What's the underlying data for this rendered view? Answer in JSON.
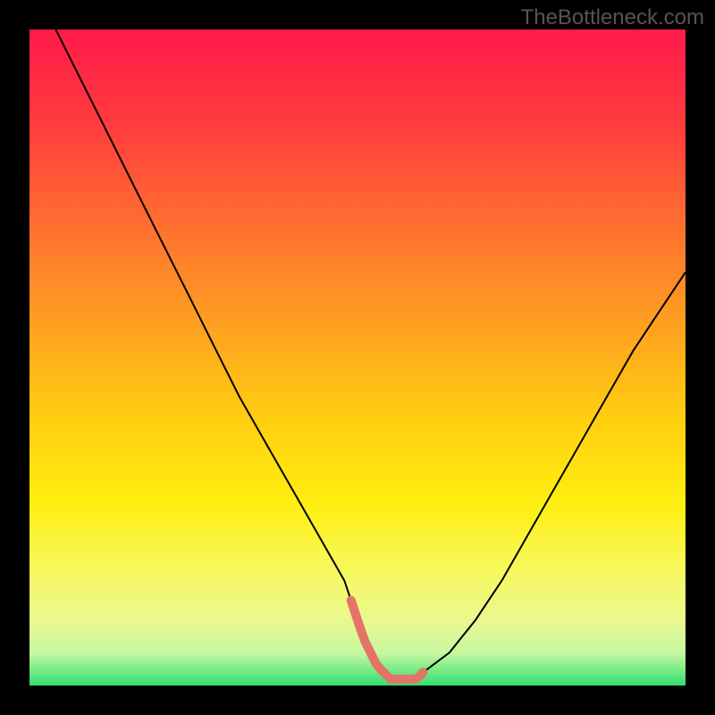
{
  "watermark": "TheBottleneck.com",
  "chart_data": {
    "type": "line",
    "title": "",
    "xlabel": "",
    "ylabel": "",
    "xlim": [
      0,
      100
    ],
    "ylim": [
      0,
      100
    ],
    "x": [
      4,
      8,
      12,
      16,
      20,
      24,
      28,
      32,
      36,
      40,
      44,
      48,
      49,
      50,
      51,
      52,
      53,
      54,
      55,
      56,
      57,
      58,
      59,
      60,
      64,
      68,
      72,
      76,
      80,
      84,
      88,
      92,
      96,
      100
    ],
    "values": [
      100,
      92,
      84,
      76,
      68,
      60,
      52,
      44,
      37,
      30,
      23,
      16,
      13,
      10,
      7,
      5,
      3,
      2,
      1,
      1,
      1,
      1,
      1,
      2,
      5,
      10,
      16,
      23,
      30,
      37,
      44,
      51,
      57,
      63
    ],
    "optimal_marker": {
      "x_start": 49,
      "x_end": 60
    },
    "gradient_stops": [
      {
        "offset": 0,
        "color": "#ff1a4a"
      },
      {
        "offset": 15,
        "color": "#ff3d3d"
      },
      {
        "offset": 30,
        "color": "#ff7030"
      },
      {
        "offset": 45,
        "color": "#ffa020"
      },
      {
        "offset": 60,
        "color": "#ffd010"
      },
      {
        "offset": 72,
        "color": "#ffee10"
      },
      {
        "offset": 82,
        "color": "#f8f85a"
      },
      {
        "offset": 90,
        "color": "#eaf890"
      },
      {
        "offset": 95,
        "color": "#c8f8a0"
      },
      {
        "offset": 100,
        "color": "#30e070"
      }
    ]
  }
}
